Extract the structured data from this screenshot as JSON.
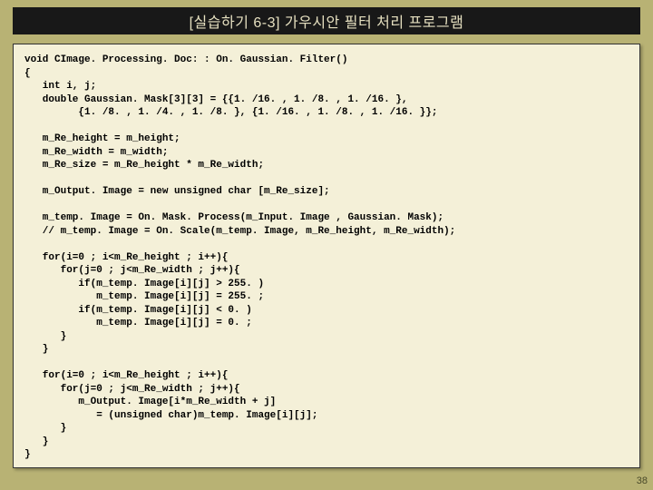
{
  "header": {
    "title": "[실습하기 6-3] 가우시안 필터 처리 프로그램"
  },
  "code_block": {
    "text": "void CImage. Processing. Doc: : On. Gaussian. Filter()\n{\n   int i, j;\n   double Gaussian. Mask[3][3] = {{1. /16. , 1. /8. , 1. /16. },\n         {1. /8. , 1. /4. , 1. /8. }, {1. /16. , 1. /8. , 1. /16. }};\n\n   m_Re_height = m_height;\n   m_Re_width = m_width;\n   m_Re_size = m_Re_height * m_Re_width;\n\n   m_Output. Image = new unsigned char [m_Re_size];\n\n   m_temp. Image = On. Mask. Process(m_Input. Image , Gaussian. Mask);\n   // m_temp. Image = On. Scale(m_temp. Image, m_Re_height, m_Re_width);\n\n   for(i=0 ; i<m_Re_height ; i++){\n      for(j=0 ; j<m_Re_width ; j++){\n         if(m_temp. Image[i][j] > 255. )\n            m_temp. Image[i][j] = 255. ;\n         if(m_temp. Image[i][j] < 0. )\n            m_temp. Image[i][j] = 0. ;\n      }\n   }\n\n   for(i=0 ; i<m_Re_height ; i++){\n      for(j=0 ; j<m_Re_width ; j++){\n         m_Output. Image[i*m_Re_width + j]\n            = (unsigned char)m_temp. Image[i][j];\n      }\n   }\n}"
  },
  "footer": {
    "page_number": "38"
  }
}
